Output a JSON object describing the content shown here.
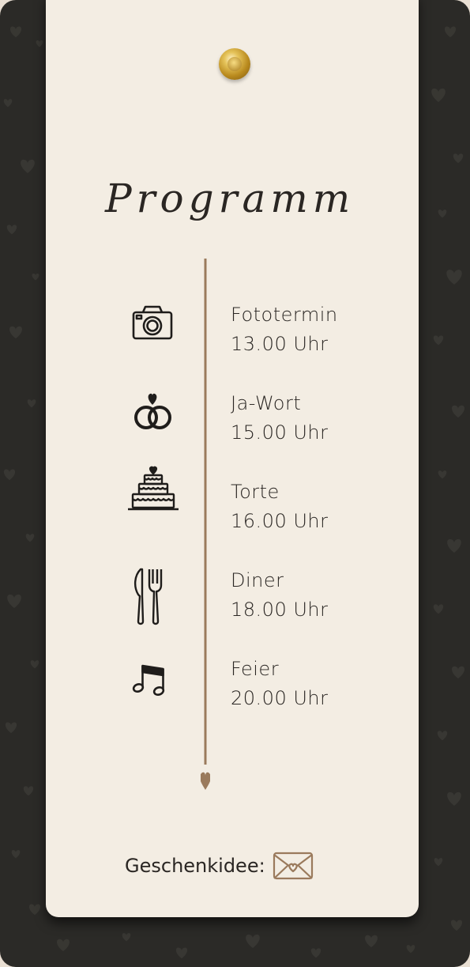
{
  "card": {
    "title": "Programm",
    "accent_color": "#9a7a5c",
    "background_color": "#2b2a27",
    "paper_color": "#f3ede3"
  },
  "schedule": [
    {
      "icon": "camera-icon",
      "event": "Fototermin",
      "time": "13.00 Uhr"
    },
    {
      "icon": "wedding-rings-icon",
      "event": "Ja-Wort",
      "time": "15.00 Uhr"
    },
    {
      "icon": "wedding-cake-icon",
      "event": "Torte",
      "time": "16.00 Uhr"
    },
    {
      "icon": "fork-knife-icon",
      "event": "Diner",
      "time": "18.00 Uhr"
    },
    {
      "icon": "music-notes-icon",
      "event": "Feier",
      "time": "20.00 Uhr"
    }
  ],
  "gift": {
    "label": "Geschenkidee:",
    "icon": "envelope-heart-icon"
  }
}
